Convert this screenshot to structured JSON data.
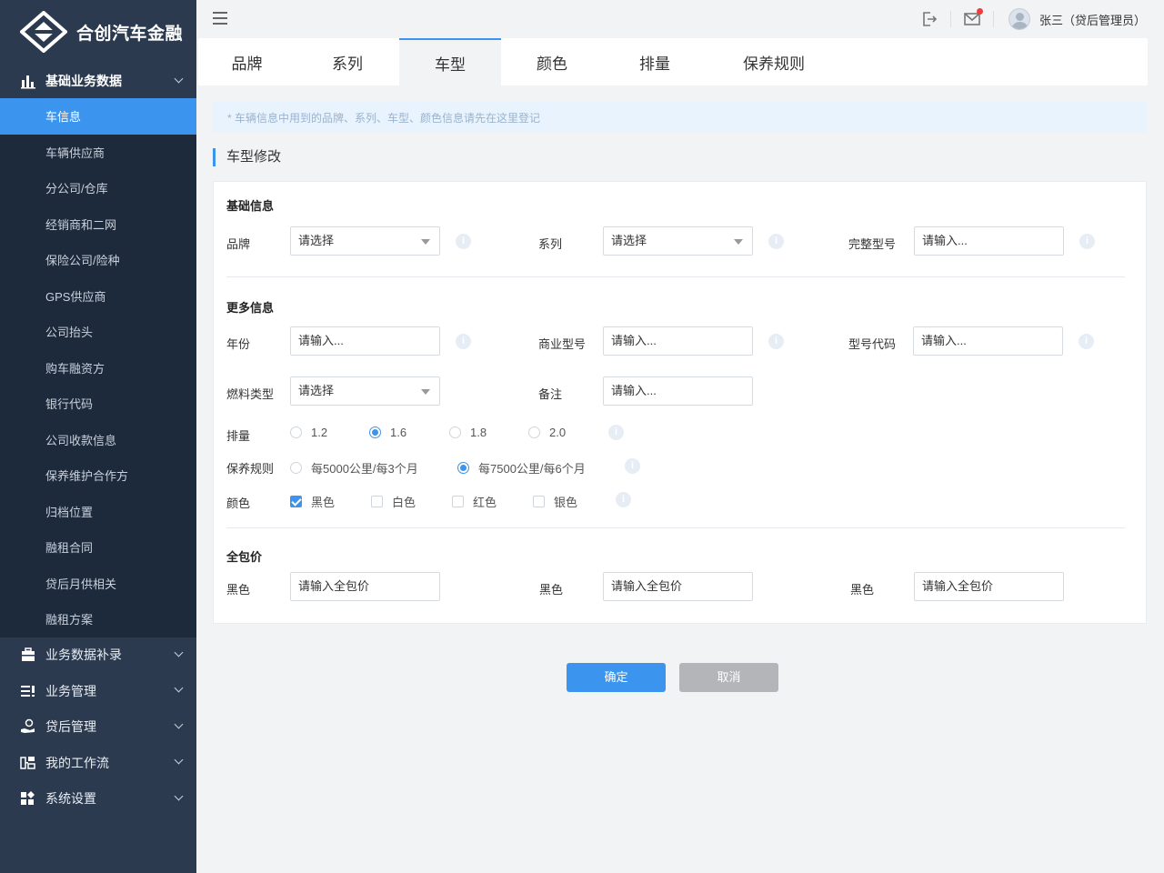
{
  "app": {
    "name": "合创汽车金融"
  },
  "sidebar": {
    "group1": {
      "label": "基础业务数据",
      "icon": "bar-chart-icon"
    },
    "sub_items": [
      {
        "label": "车信息",
        "active": true
      },
      {
        "label": "车辆供应商"
      },
      {
        "label": "分公司/仓库"
      },
      {
        "label": "经销商和二网"
      },
      {
        "label": "保险公司/险种"
      },
      {
        "label": "GPS供应商"
      },
      {
        "label": "公司抬头"
      },
      {
        "label": "购车融资方"
      },
      {
        "label": "银行代码"
      },
      {
        "label": "公司收款信息"
      },
      {
        "label": "保养维护合作方"
      },
      {
        "label": "归档位置"
      },
      {
        "label": "融租合同"
      },
      {
        "label": "贷后月供相关"
      },
      {
        "label": "融租方案"
      }
    ],
    "groups": [
      {
        "label": "业务数据补录",
        "icon": "briefcase-icon"
      },
      {
        "label": "业务管理",
        "icon": "list-icon"
      },
      {
        "label": "贷后管理",
        "icon": "hand-money-icon"
      },
      {
        "label": "我的工作流",
        "icon": "workflow-icon"
      },
      {
        "label": "系统设置",
        "icon": "settings-grid-icon"
      }
    ]
  },
  "topbar": {
    "user_name": "张三（贷后管理员）",
    "icons": [
      "logout-icon",
      "mail-icon",
      "avatar"
    ],
    "mail_unread": true
  },
  "tabs": [
    {
      "label": "品牌"
    },
    {
      "label": "系列"
    },
    {
      "label": "车型",
      "active": true
    },
    {
      "label": "颜色"
    },
    {
      "label": "排量"
    },
    {
      "label": "保养规则"
    }
  ],
  "notice": "* 车辆信息中用到的品牌、系列、车型、颜色信息请先在这里登记",
  "section_title": "车型修改",
  "form": {
    "basic": {
      "heading": "基础信息",
      "brand": {
        "label": "品牌",
        "value": "请选择"
      },
      "series": {
        "label": "系列",
        "value": "请选择"
      },
      "full_model": {
        "label": "完整型号",
        "placeholder": "请输入..."
      }
    },
    "more": {
      "heading": "更多信息",
      "year": {
        "label": "年份",
        "placeholder": "请输入..."
      },
      "commercial_model": {
        "label": "商业型号",
        "placeholder": "请输入..."
      },
      "model_code": {
        "label": "型号代码",
        "placeholder": "请输入..."
      },
      "fuel_type": {
        "label": "燃料类型",
        "value": "请选择"
      },
      "remark": {
        "label": "备注",
        "placeholder": "请输入..."
      },
      "displacement": {
        "label": "排量",
        "options": [
          "1.2",
          "1.6",
          "1.8",
          "2.0"
        ],
        "selected": "1.6"
      },
      "maintenance": {
        "label": "保养规则",
        "options": [
          "每5000公里/每3个月",
          "每7500公里/每6个月"
        ],
        "selected": "每7500公里/每6个月"
      },
      "color": {
        "label": "颜色",
        "options": [
          "黑色",
          "白色",
          "红色",
          "银色"
        ],
        "checked": [
          "黑色"
        ]
      }
    },
    "price": {
      "heading": "全包价",
      "items": [
        {
          "label": "黑色",
          "placeholder": "请输入全包价"
        },
        {
          "label": "黑色",
          "placeholder": "请输入全包价"
        },
        {
          "label": "黑色",
          "placeholder": "请输入全包价"
        }
      ]
    }
  },
  "buttons": {
    "ok": "确定",
    "cancel": "取消"
  },
  "colors": {
    "primary": "#3b94ee",
    "sidebar": "#2b3a4f",
    "sidebar_sub": "#1d2a3b",
    "cancel": "#b3b5b8"
  }
}
